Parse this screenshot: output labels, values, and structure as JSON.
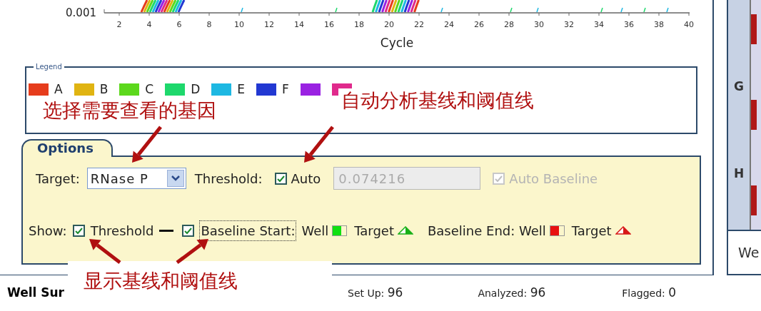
{
  "chart": {
    "y_tick": "0.001",
    "x_ticks": [
      "2",
      "4",
      "6",
      "8",
      "10",
      "12",
      "14",
      "16",
      "18",
      "20",
      "22",
      "24",
      "26",
      "28",
      "30",
      "32",
      "34",
      "36",
      "38",
      "40"
    ],
    "x_label": "Cycle"
  },
  "legend": {
    "title": "Legend",
    "items": [
      {
        "label": "A",
        "color": "#e63c1c"
      },
      {
        "label": "B",
        "color": "#e0b412"
      },
      {
        "label": "C",
        "color": "#5cd81c"
      },
      {
        "label": "D",
        "color": "#1ed86c"
      },
      {
        "label": "E",
        "color": "#1eb8e2"
      },
      {
        "label": "F",
        "color": "#2238d2"
      },
      {
        "color": "#9a22e2"
      },
      {
        "color": "#e02a8c"
      }
    ]
  },
  "options": {
    "tab": "Options",
    "target_label": "Target:",
    "target_value": "RNase P",
    "threshold_label": "Threshold:",
    "auto_threshold": {
      "label": "Auto",
      "checked": true
    },
    "threshold_value": "0.074216",
    "threshold_disabled": true,
    "auto_baseline": {
      "label": "Auto Baseline",
      "checked": true,
      "disabled": true
    },
    "show_label": "Show:",
    "show_items": [
      {
        "kind": "checkbox",
        "label": "Threshold",
        "checked": true,
        "focused": false
      },
      {
        "kind": "line"
      },
      {
        "kind": "checkbox",
        "label": "Baseline Start:",
        "checked": true,
        "focused": true
      },
      {
        "kind": "text",
        "label": "Well"
      },
      {
        "kind": "well",
        "color": "#10e010"
      },
      {
        "kind": "text",
        "label": "Target"
      },
      {
        "kind": "triangle",
        "color": "#18b018"
      },
      {
        "kind": "text",
        "label": "Baseline End: Well"
      },
      {
        "kind": "well",
        "color": "#e81010"
      },
      {
        "kind": "text",
        "label": "Target"
      },
      {
        "kind": "triangle",
        "color": "#d81818"
      }
    ]
  },
  "summary": {
    "title": "Well Sur",
    "counts": [
      {
        "label": "Set Up:",
        "value": "96"
      },
      {
        "label": "Analyzed:",
        "value": "96"
      },
      {
        "label": "Flagged:",
        "value": "0"
      }
    ]
  },
  "plate": {
    "rows": [
      "G",
      "H"
    ],
    "tab": "We"
  },
  "annotations": [
    {
      "text": "选择需要查看的基因"
    },
    {
      "text": "自动分析基线和阈值线"
    },
    {
      "text": "显示基线和阈值线"
    }
  ]
}
